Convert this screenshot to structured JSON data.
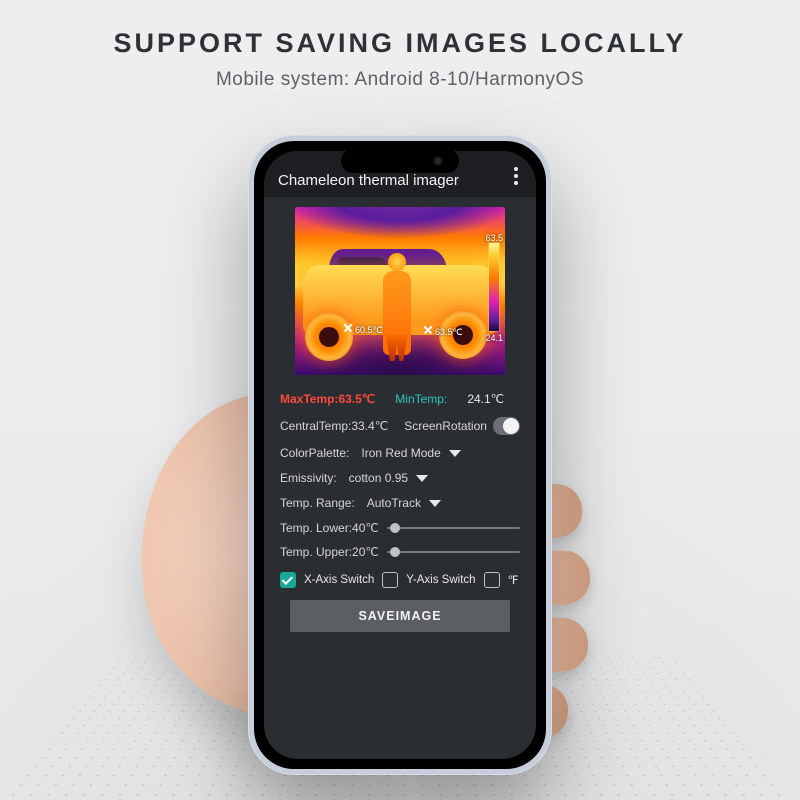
{
  "headline": "SUPPORT SAVING IMAGES LOCALLY",
  "subhead": "Mobile system: Android 8-10/HarmonyOS",
  "app": {
    "title": "Chameleon thermal imager"
  },
  "thermal": {
    "marker_low": "60.5℃",
    "marker_high": "63.5℃",
    "bar_top": "63.5",
    "bar_bottom": "24.1"
  },
  "readout": {
    "max_label": "MaxTemp:63.5℃",
    "min_label": "MinTemp:",
    "min_value": "24.1℃",
    "central": "CentralTemp:33.4℃",
    "rotation_label": "ScreenRotation",
    "palette_label": "ColorPalette:",
    "palette_value": "Iron Red Mode",
    "emissivity_label": "Emissivity:",
    "emissivity_value": "cotton 0.95",
    "range_label": "Temp. Range:",
    "range_value": "AutoTrack",
    "lower_label": "Temp. Lower:40℃",
    "upper_label": "Temp. Upper:20℃",
    "xaxis": "X-Axis Switch",
    "yaxis": "Y-Axis Switch",
    "fahrenheit": "℉",
    "save": "SAVEIMAGE"
  }
}
